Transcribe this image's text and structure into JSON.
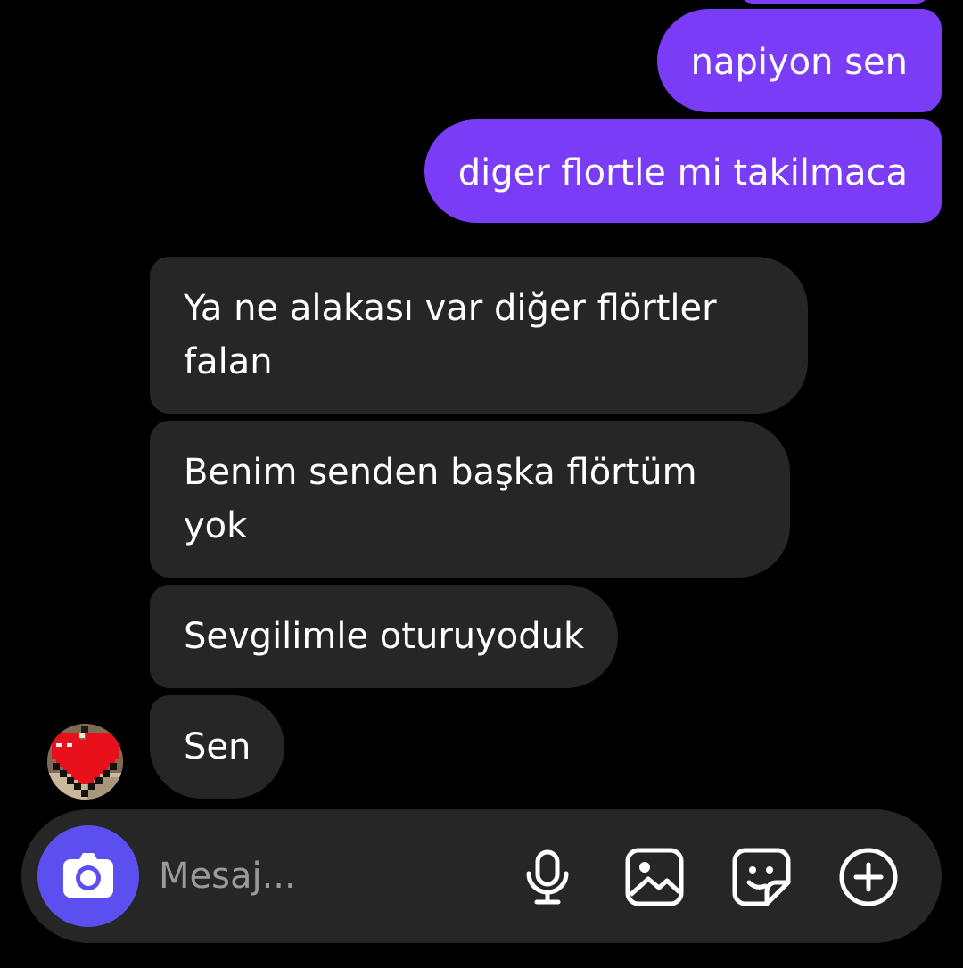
{
  "theme": {
    "background": "#000000",
    "outgoing_bubble_color": "#7a3cf6",
    "incoming_bubble_color": "#262626",
    "composer_color": "#262626",
    "camera_button_color": "#5b4ff0",
    "text_color": "#ffffff",
    "placeholder_color": "#9a9a9a"
  },
  "conversation": {
    "messages": [
      {
        "direction": "outgoing",
        "text": "napiyon sen"
      },
      {
        "direction": "outgoing",
        "text": "diger flortle mi takilmaca"
      },
      {
        "direction": "incoming",
        "line1": "Ya ne alakası var diğer flörtler",
        "line2": "falan"
      },
      {
        "direction": "incoming",
        "line1": "Benim senden başka flörtüm",
        "line2": "yok"
      },
      {
        "direction": "incoming",
        "text": "Sevgilimle oturuyoduk"
      },
      {
        "direction": "incoming",
        "text": "Sen"
      }
    ],
    "contact_avatar": {
      "icon": "pixel-heart-avatar",
      "accent": "#e8101a"
    }
  },
  "composer": {
    "placeholder": "Mesaj...",
    "value": "",
    "buttons": [
      {
        "icon": "camera-icon"
      },
      {
        "icon": "microphone-icon"
      },
      {
        "icon": "gallery-icon"
      },
      {
        "icon": "sticker-icon"
      },
      {
        "icon": "plus-circle-icon"
      }
    ]
  }
}
